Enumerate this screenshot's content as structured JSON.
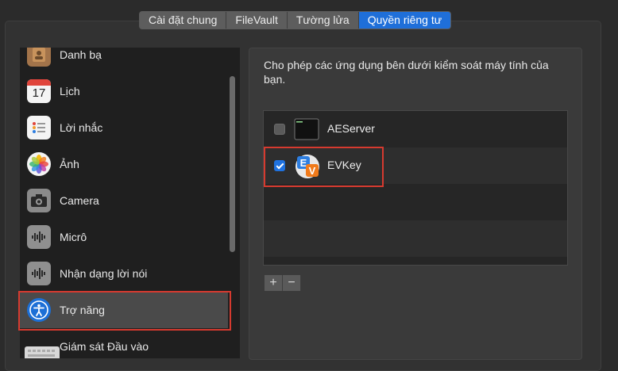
{
  "tabs": [
    {
      "label": "Cài đặt chung",
      "active": false
    },
    {
      "label": "FileVault",
      "active": false
    },
    {
      "label": "Tường lửa",
      "active": false
    },
    {
      "label": "Quyền riêng tư",
      "active": true
    }
  ],
  "sidebar": {
    "items": [
      {
        "label": "Danh bạ",
        "icon": "contacts-icon"
      },
      {
        "label": "Lịch",
        "icon": "calendar-icon",
        "calendar_day": "17"
      },
      {
        "label": "Lời nhắc",
        "icon": "reminders-icon"
      },
      {
        "label": "Ảnh",
        "icon": "photos-icon"
      },
      {
        "label": "Camera",
        "icon": "camera-icon"
      },
      {
        "label": "Micrô",
        "icon": "microphone-icon"
      },
      {
        "label": "Nhận dạng lời nói",
        "icon": "speech-recognition-icon"
      },
      {
        "label": "Trợ năng",
        "icon": "accessibility-icon",
        "selected": true
      },
      {
        "label": "Giám sát Đầu vào",
        "icon": "keyboard-icon"
      }
    ]
  },
  "main": {
    "description": "Cho phép các ứng dụng bên dưới kiểm soát máy tính của bạn.",
    "apps": [
      {
        "name": "AEServer",
        "checked": false,
        "icon": "terminal-icon"
      },
      {
        "name": "EVKey",
        "checked": true,
        "icon": "evkey-icon"
      }
    ],
    "add_label": "+",
    "remove_label": "−"
  },
  "colors": {
    "accent": "#1f6fd9",
    "highlight_outline": "#d63a2f"
  }
}
